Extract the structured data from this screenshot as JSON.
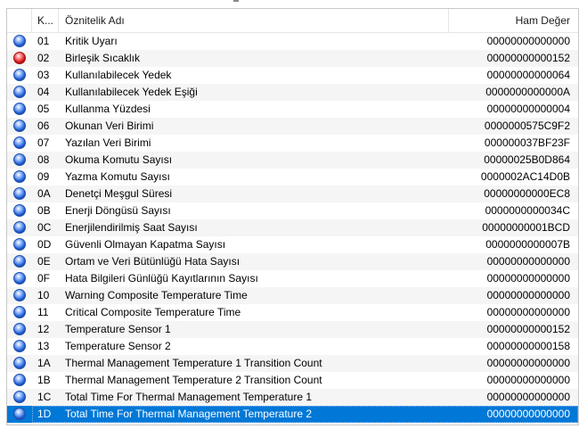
{
  "header": {
    "id_label": "K...",
    "name_label": "Öznitelik Adı",
    "raw_label": "Ham Değer"
  },
  "colors": {
    "good": "#2f6fe6",
    "bad": "#e22020",
    "selected": "#0078d7"
  },
  "rows": [
    {
      "id": "01",
      "name": "Kritik Uyarı",
      "raw": "00000000000000",
      "status": "good-icon"
    },
    {
      "id": "02",
      "name": "Birleşik Sıcaklık",
      "raw": "00000000000152",
      "status": "bad-icon"
    },
    {
      "id": "03",
      "name": "Kullanılabilecek Yedek",
      "raw": "00000000000064",
      "status": "good-icon"
    },
    {
      "id": "04",
      "name": "Kullanılabilecek Yedek Eşiği",
      "raw": "0000000000000A",
      "status": "good-icon"
    },
    {
      "id": "05",
      "name": "Kullanma Yüzdesi",
      "raw": "00000000000004",
      "status": "good-icon"
    },
    {
      "id": "06",
      "name": "Okunan Veri Birimi",
      "raw": "0000000575C9F2",
      "status": "good-icon"
    },
    {
      "id": "07",
      "name": "Yazılan Veri Birimi",
      "raw": "000000037BF23F",
      "status": "good-icon"
    },
    {
      "id": "08",
      "name": "Okuma Komutu Sayısı",
      "raw": "00000025B0D864",
      "status": "good-icon"
    },
    {
      "id": "09",
      "name": "Yazma Komutu Sayısı",
      "raw": "0000002AC14D0B",
      "status": "good-icon"
    },
    {
      "id": "0A",
      "name": "Denetçi Meşgul Süresi",
      "raw": "00000000000EC8",
      "status": "good-icon"
    },
    {
      "id": "0B",
      "name": "Enerji Döngüsü Sayısı",
      "raw": "0000000000034C",
      "status": "good-icon"
    },
    {
      "id": "0C",
      "name": "Enerjilendirilmiş Saat Sayısı",
      "raw": "00000000001BCD",
      "status": "good-icon"
    },
    {
      "id": "0D",
      "name": "Güvenli Olmayan Kapatma Sayısı",
      "raw": "0000000000007B",
      "status": "good-icon"
    },
    {
      "id": "0E",
      "name": "Ortam ve Veri Bütünlüğü Hata Sayısı",
      "raw": "00000000000000",
      "status": "good-icon"
    },
    {
      "id": "0F",
      "name": "Hata Bilgileri Günlüğü Kayıtlarının Sayısı",
      "raw": "00000000000000",
      "status": "good-icon"
    },
    {
      "id": "10",
      "name": "Warning Composite Temperature Time",
      "raw": "00000000000000",
      "status": "good-icon"
    },
    {
      "id": "11",
      "name": "Critical Composite Temperature Time",
      "raw": "00000000000000",
      "status": "good-icon"
    },
    {
      "id": "12",
      "name": "Temperature Sensor 1",
      "raw": "00000000000152",
      "status": "good-icon"
    },
    {
      "id": "13",
      "name": "Temperature Sensor 2",
      "raw": "00000000000158",
      "status": "good-icon"
    },
    {
      "id": "1A",
      "name": "Thermal Management Temperature 1 Transition Count",
      "raw": "00000000000000",
      "status": "good-icon"
    },
    {
      "id": "1B",
      "name": "Thermal Management Temperature 2 Transition Count",
      "raw": "00000000000000",
      "status": "good-icon"
    },
    {
      "id": "1C",
      "name": "Total Time For Thermal Management Temperature 1",
      "raw": "00000000000000",
      "status": "good-icon"
    },
    {
      "id": "1D",
      "name": "Total Time For Thermal Management Temperature 2",
      "raw": "00000000000000",
      "status": "good-icon",
      "selected": true
    }
  ]
}
